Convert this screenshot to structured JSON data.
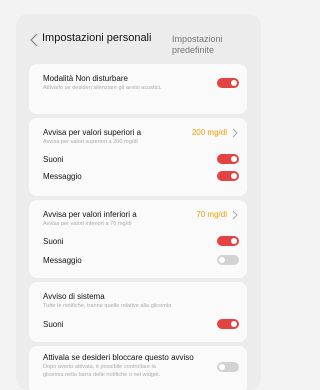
{
  "header": {
    "title": "Impostazioni personali",
    "defaults_link": "Impostazioni predefinite"
  },
  "dnd": {
    "label": "Modalità Non disturbare",
    "description": "Attivarlo se desideri silenziare gli avvisi acustici.",
    "enabled": true
  },
  "high_alert": {
    "label": "Avvisa per valori superiori a",
    "description": "Avvisa per valori superiori a 200 mg/dl",
    "value": "200 mg/dl",
    "sound_label": "Suoni",
    "sound_enabled": true,
    "message_label": "Messaggio",
    "message_enabled": true
  },
  "low_alert": {
    "label": "Avvisa per valori inferiori a",
    "description": "Avvisa per valori inferiori a 70 mg/dl",
    "value": "70 mg/dl",
    "sound_label": "Suoni",
    "sound_enabled": true,
    "message_label": "Messaggio",
    "message_enabled": false
  },
  "system_alert": {
    "label": "Avviso di sistema",
    "description": "Tutte le notifiche, tranne quelle relative alla glicemia",
    "sound_label": "Suoni",
    "sound_enabled": true
  },
  "lock_alert": {
    "label": "Attivala se desideri bloccare questo avviso",
    "description_line1": "Dopo averla attivata, è possibile controllare la",
    "description_line2": "glicemia nella barra delle notifiche o nel widget.",
    "enabled": false
  },
  "colors": {
    "accent_red": "#e24343",
    "value_orange": "#f0a000"
  }
}
